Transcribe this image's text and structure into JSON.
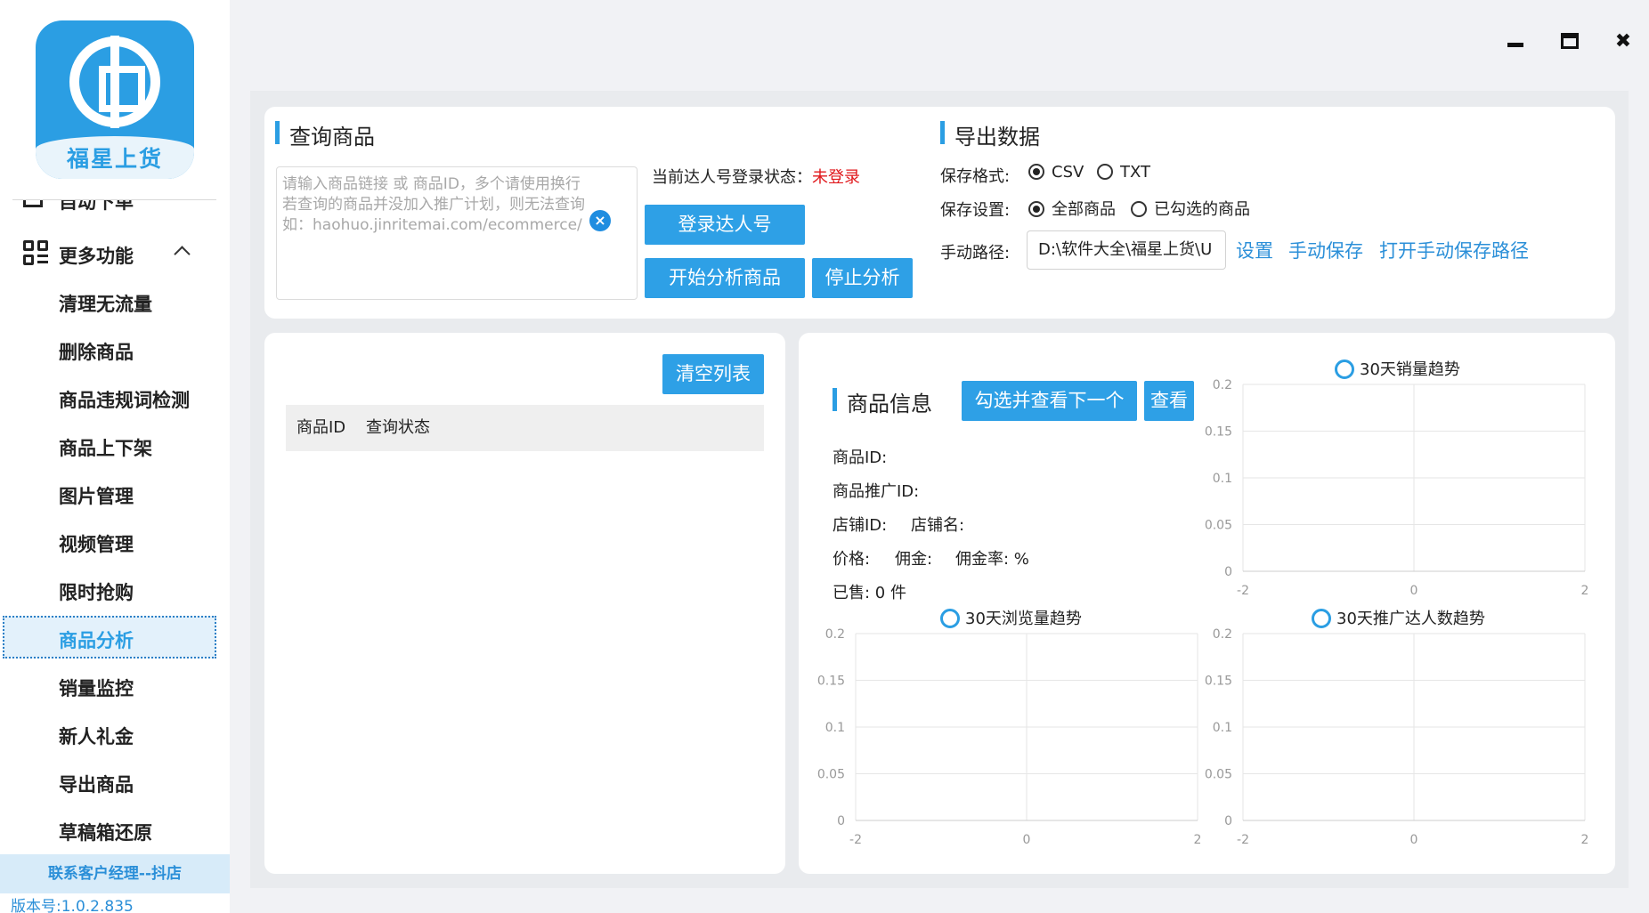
{
  "app": {
    "logo_text": "福星上货",
    "version": "版本号:1.0.2.835",
    "contact": "联系客户经理--抖店"
  },
  "sidebar": {
    "clipped_item": "自动下单",
    "group_label": "更多功能",
    "items": [
      "清理无流量",
      "删除商品",
      "商品违规词检测",
      "商品上下架",
      "图片管理",
      "视频管理",
      "限时抢购"
    ],
    "active_item": "商品分析",
    "items_after": [
      "销量监控",
      "新人礼金",
      "导出商品",
      "草稿箱还原"
    ]
  },
  "query": {
    "title": "查询商品",
    "placeholder_lines": [
      "请输入商品链接 或 商品ID，多个请使用换行",
      "若查询的商品并没加入推广计划，则无法查询",
      "如：haohuo.jinritemai.com/ecommerce/"
    ],
    "status_label": "当前达人号登录状态：",
    "status_value": "未登录",
    "login_button": "登录达人号",
    "start_button": "开始分析商品",
    "stop_button": "停止分析"
  },
  "export": {
    "title": "导出数据",
    "format_label": "保存格式:",
    "format_options": [
      "CSV",
      "TXT"
    ],
    "format_selected": "CSV",
    "setting_label": "保存设置:",
    "setting_options": [
      "全部商品",
      "已勾选的商品"
    ],
    "setting_selected": "全部商品",
    "path_label": "手动路径:",
    "path_value": "D:\\软件大全\\福星上货\\U",
    "link_settings": "设置",
    "link_manual_save": "手动保存",
    "link_open_path": "打开手动保存路径"
  },
  "list": {
    "clear_button": "清空列表",
    "columns": [
      "商品ID",
      "查询状态"
    ]
  },
  "product_info": {
    "title": "商品信息",
    "select_next_button": "勾选并查看下一个",
    "view_button": "查看",
    "id_label": "商品ID:",
    "promo_id_label": "商品推广ID:",
    "shop_id_label": "店铺ID:",
    "shop_name_label": "店铺名:",
    "price_label": "价格:",
    "commission_label": "佣金:",
    "commission_rate_label": "佣金率: %",
    "sold_label": "已售: 0 件"
  },
  "chart_data": [
    {
      "type": "line",
      "title": "30天销量趋势",
      "series": [
        {
          "name": "30天销量趋势",
          "values": []
        }
      ],
      "xticks": [
        "-2",
        "0",
        "2"
      ],
      "yticks": [
        "0",
        "0.05",
        "0.1",
        "0.15",
        "0.2"
      ],
      "xlim": [
        -2,
        2
      ],
      "ylim": [
        0,
        0.2
      ]
    },
    {
      "type": "line",
      "title": "30天浏览量趋势",
      "series": [
        {
          "name": "30天浏览量趋势",
          "values": []
        }
      ],
      "xticks": [
        "-2",
        "0",
        "2"
      ],
      "yticks": [
        "0",
        "0.05",
        "0.1",
        "0.15",
        "0.2"
      ],
      "xlim": [
        -2,
        2
      ],
      "ylim": [
        0,
        0.2
      ]
    },
    {
      "type": "line",
      "title": "30天推广达人数趋势",
      "series": [
        {
          "name": "30天推广达人数趋势",
          "values": []
        }
      ],
      "xticks": [
        "-2",
        "0",
        "2"
      ],
      "yticks": [
        "0",
        "0.05",
        "0.1",
        "0.15",
        "0.2"
      ],
      "xlim": [
        -2,
        2
      ],
      "ylim": [
        0,
        0.2
      ]
    }
  ],
  "colors": {
    "accent": "#2b9ee3",
    "status_red": "#e0171b",
    "background": "#f1f2f5"
  }
}
